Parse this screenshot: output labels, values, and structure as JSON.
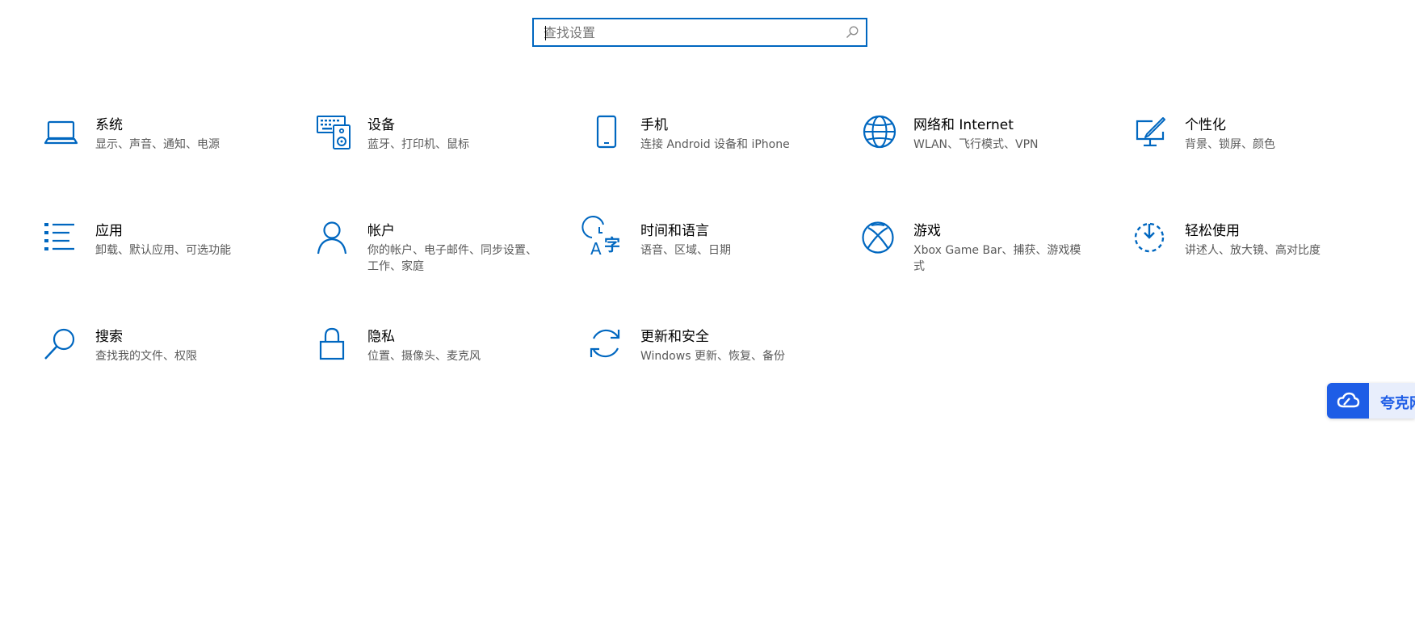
{
  "search": {
    "placeholder": "查找设置"
  },
  "tiles": [
    {
      "title": "系统",
      "desc": "显示、声音、通知、电源",
      "icon": "laptop-icon"
    },
    {
      "title": "设备",
      "desc": "蓝牙、打印机、鼠标",
      "icon": "devices-icon"
    },
    {
      "title": "手机",
      "desc": "连接 Android 设备和 iPhone",
      "icon": "phone-icon"
    },
    {
      "title": "网络和 Internet",
      "desc": "WLAN、飞行模式、VPN",
      "icon": "globe-icon"
    },
    {
      "title": "个性化",
      "desc": "背景、锁屏、颜色",
      "icon": "personalization-icon"
    },
    {
      "title": "应用",
      "desc": "卸载、默认应用、可选功能",
      "icon": "apps-list-icon"
    },
    {
      "title": "帐户",
      "desc": "你的帐户、电子邮件、同步设置、工作、家庭",
      "icon": "person-icon"
    },
    {
      "title": "时间和语言",
      "desc": "语音、区域、日期",
      "icon": "time-language-icon"
    },
    {
      "title": "游戏",
      "desc": "Xbox Game Bar、捕获、游戏模式",
      "icon": "xbox-icon"
    },
    {
      "title": "轻松使用",
      "desc": "讲述人、放大镜、高对比度",
      "icon": "ease-of-access-icon"
    },
    {
      "title": "搜索",
      "desc": "查找我的文件、权限",
      "icon": "search-icon"
    },
    {
      "title": "隐私",
      "desc": "位置、摄像头、麦克风",
      "icon": "lock-icon"
    },
    {
      "title": "更新和安全",
      "desc": "Windows 更新、恢复、备份",
      "icon": "update-icon"
    }
  ],
  "float_widget": {
    "label": "夸克网",
    "icon": "cloud-icon"
  },
  "colors": {
    "accent": "#0067c0",
    "widget": "#1e5de6"
  }
}
